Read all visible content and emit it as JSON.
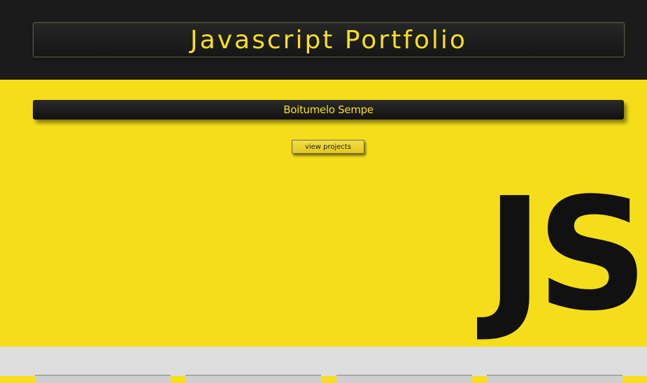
{
  "header": {
    "title": "Javascript Portfolio"
  },
  "hero": {
    "name": "Boitumelo Sempe",
    "view_projects_label": "view projects",
    "logo_text": "JS"
  },
  "colors": {
    "accent": "#f7df1e",
    "dark": "#1b1b1b",
    "light": "#dedede"
  }
}
